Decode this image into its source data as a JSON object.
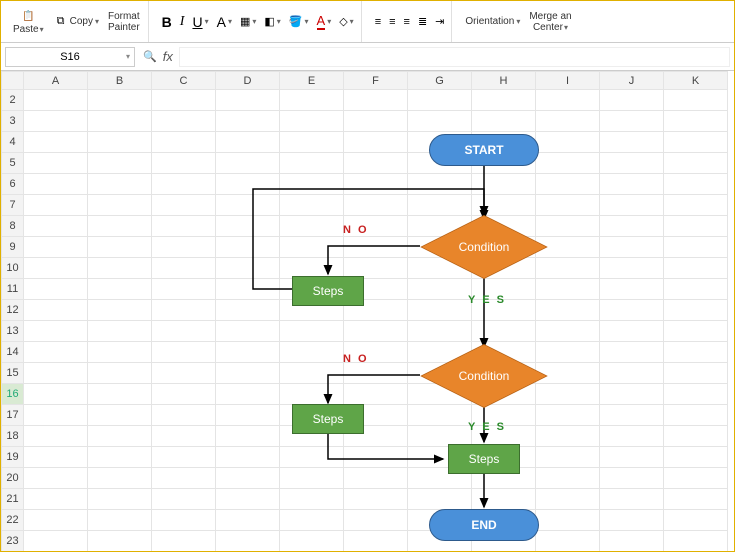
{
  "toolbar": {
    "paste": "Paste",
    "copy": "Copy",
    "format_painter_l1": "Format",
    "format_painter_l2": "Painter",
    "orientation": "Orientation",
    "merge_l1": "Merge an",
    "merge_l2": "Center"
  },
  "formula": {
    "name_box": "S16",
    "fx": "fx"
  },
  "grid": {
    "cols": [
      "A",
      "B",
      "C",
      "D",
      "E",
      "F",
      "G",
      "H",
      "I",
      "J",
      "K"
    ],
    "rows": [
      "2",
      "3",
      "4",
      "5",
      "6",
      "7",
      "8",
      "9",
      "10",
      "11",
      "12",
      "13",
      "14",
      "15",
      "16",
      "17",
      "18",
      "19",
      "20",
      "21",
      "22",
      "23"
    ],
    "selected_row": "16"
  },
  "flow": {
    "start": "START",
    "end": "END",
    "condition1": "Condition",
    "condition2": "Condition",
    "steps1": "Steps",
    "steps2": "Steps",
    "steps3": "Steps",
    "no1": "N O",
    "yes1": "Y E S",
    "no2": "N O",
    "yes2": "Y E S"
  }
}
